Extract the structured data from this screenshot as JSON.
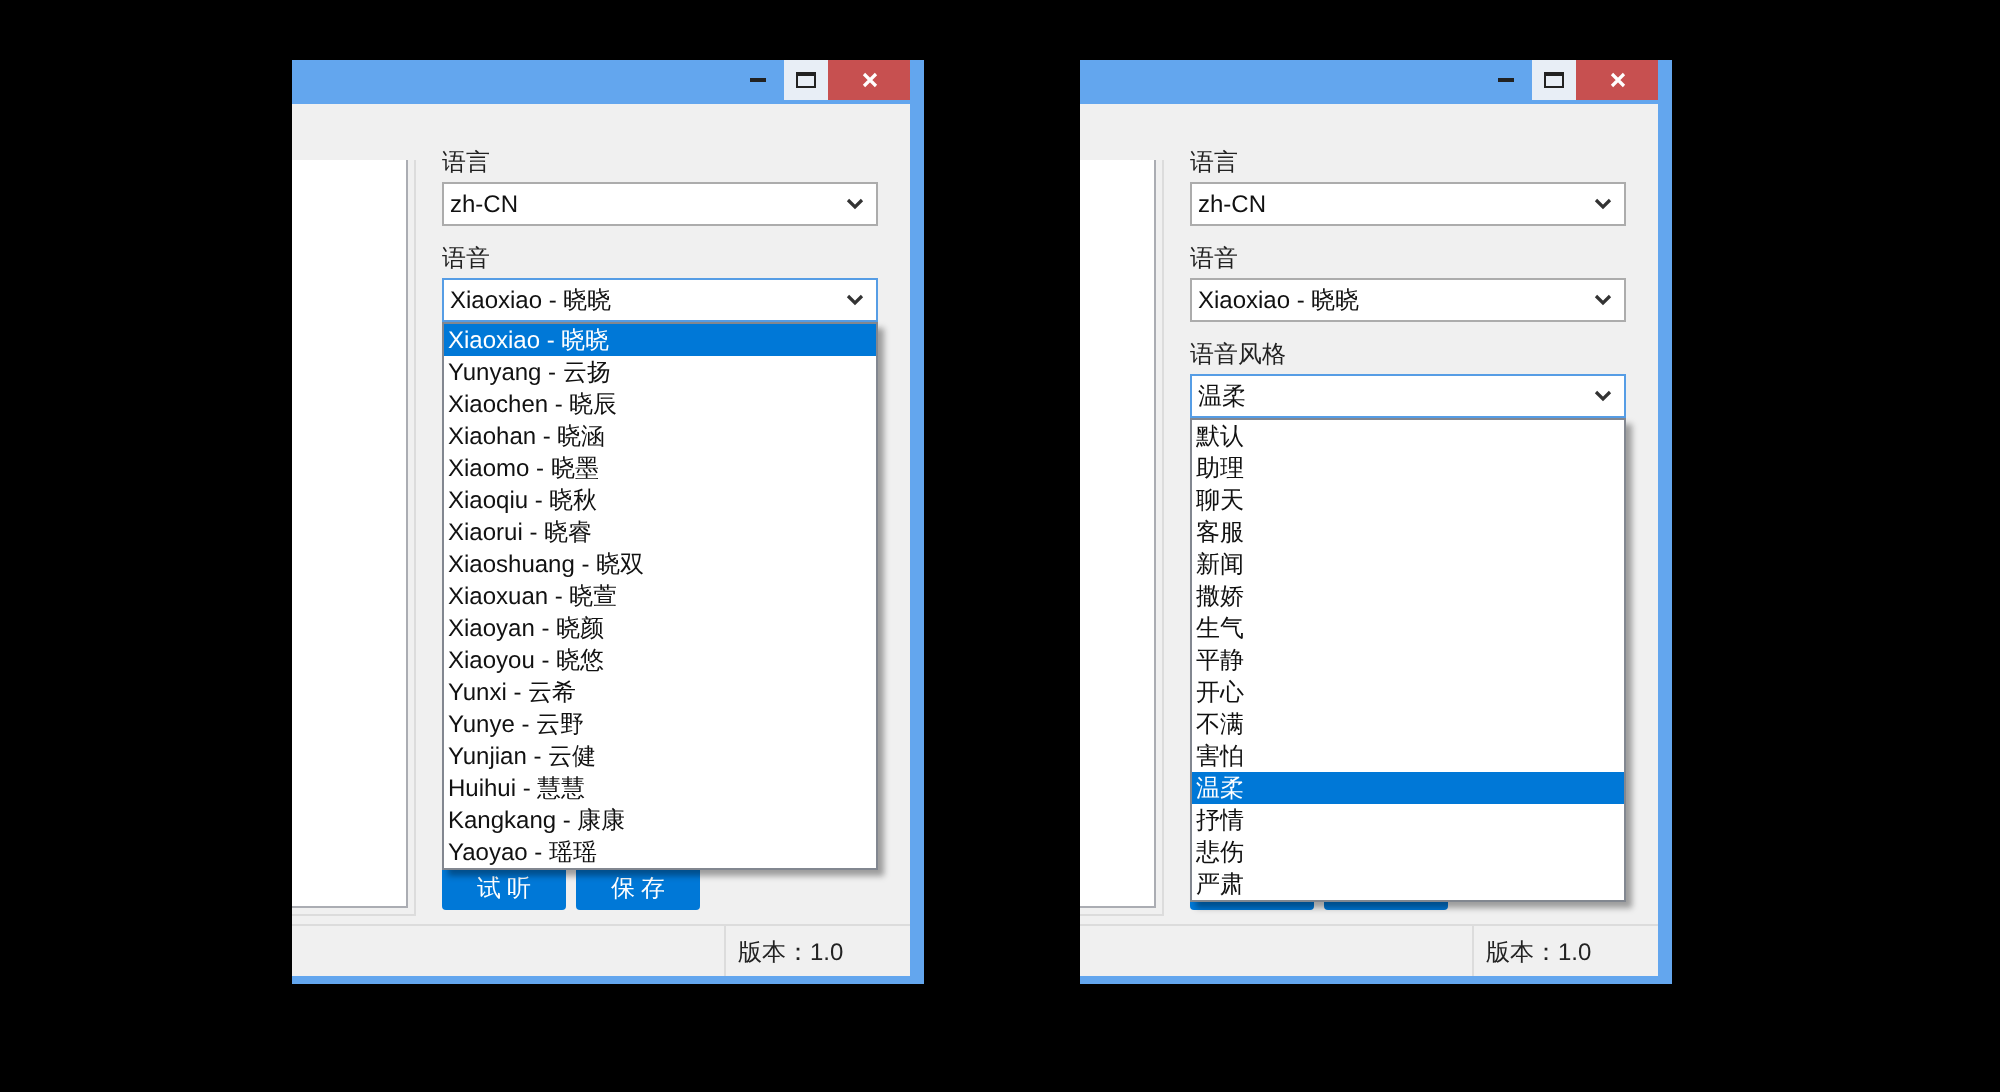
{
  "windows": [
    {
      "fields": [
        {
          "label": "语言",
          "value": "zh-CN",
          "open": false
        },
        {
          "label": "语音",
          "value": "Xiaoxiao - 晓晓",
          "open": true,
          "options": [
            {
              "label": "Xiaoxiao - 晓晓",
              "selected": true
            },
            {
              "label": "Yunyang - 云扬",
              "selected": false
            },
            {
              "label": "Xiaochen - 晓辰",
              "selected": false
            },
            {
              "label": "Xiaohan - 晓涵",
              "selected": false
            },
            {
              "label": "Xiaomo - 晓墨",
              "selected": false
            },
            {
              "label": "Xiaoqiu - 晓秋",
              "selected": false
            },
            {
              "label": "Xiaorui - 晓睿",
              "selected": false
            },
            {
              "label": "Xiaoshuang - 晓双",
              "selected": false
            },
            {
              "label": "Xiaoxuan - 晓萱",
              "selected": false
            },
            {
              "label": "Xiaoyan - 晓颜",
              "selected": false
            },
            {
              "label": "Xiaoyou - 晓悠",
              "selected": false
            },
            {
              "label": "Yunxi - 云希",
              "selected": false
            },
            {
              "label": "Yunye - 云野",
              "selected": false
            },
            {
              "label": "Yunjian - 云健",
              "selected": false
            },
            {
              "label": "Huihui - 慧慧",
              "selected": false
            },
            {
              "label": "Kangkang - 康康",
              "selected": false
            },
            {
              "label": "Yaoyao - 瑶瑶",
              "selected": false
            }
          ]
        }
      ],
      "buttons": [
        {
          "kind": "labeled",
          "label": "试 听"
        },
        {
          "kind": "labeled",
          "label": "保 存"
        }
      ],
      "status": "版本：1.0"
    },
    {
      "fields": [
        {
          "label": "语言",
          "value": "zh-CN",
          "open": false
        },
        {
          "label": "语音",
          "value": "Xiaoxiao - 晓晓",
          "open": false
        },
        {
          "label": "语音风格",
          "value": "温柔",
          "open": true,
          "options": [
            {
              "label": "默认",
              "selected": false
            },
            {
              "label": "助理",
              "selected": false
            },
            {
              "label": "聊天",
              "selected": false
            },
            {
              "label": "客服",
              "selected": false
            },
            {
              "label": "新闻",
              "selected": false
            },
            {
              "label": "撒娇",
              "selected": false
            },
            {
              "label": "生气",
              "selected": false
            },
            {
              "label": "平静",
              "selected": false
            },
            {
              "label": "开心",
              "selected": false
            },
            {
              "label": "不满",
              "selected": false
            },
            {
              "label": "害怕",
              "selected": false
            },
            {
              "label": "温柔",
              "selected": true
            },
            {
              "label": "抒情",
              "selected": false
            },
            {
              "label": "悲伤",
              "selected": false
            },
            {
              "label": "严肃",
              "selected": false
            }
          ]
        }
      ],
      "buttons": [
        {
          "kind": "covered"
        },
        {
          "kind": "covered"
        }
      ],
      "status": "版本：1.0"
    }
  ]
}
